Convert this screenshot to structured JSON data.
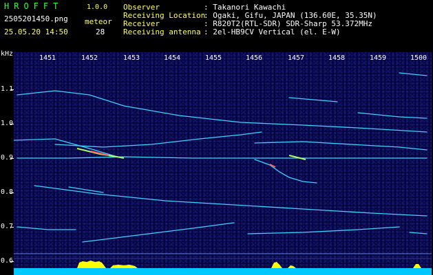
{
  "header": {
    "brand": "HROFFT",
    "version": "1.0.0",
    "filename": "2505201450.png",
    "datetime": "25.05.20 14:50",
    "meteor_label": "meteor",
    "meteor_count": "28"
  },
  "info": [
    {
      "key": "Observer",
      "value": ": Takanori Kawachi"
    },
    {
      "key": "Receiving Location",
      "value": ": Ogaki, Gifu, JAPAN (136.60E, 35.35N)"
    },
    {
      "key": "Receiver",
      "value": ": R820T2(RTL-SDR) SDR-Sharp 53.372MHz"
    },
    {
      "key": "Receiving antenna",
      "value": ": 2el-HB9CV Vertical (el. E-W)"
    }
  ],
  "axis": {
    "y_unit": "kHz",
    "y_labels": [
      "1.1",
      "1.0",
      "0.9",
      "0.8",
      "0.7",
      "0.6"
    ],
    "x_labels": [
      "1451",
      "1452",
      "1453",
      "1454",
      "1455",
      "1456",
      "1457",
      "1458",
      "1459",
      "1500"
    ]
  },
  "colors": {
    "background": "#000000",
    "plot_bg": "#06063e",
    "trace": "#3fd3ff",
    "meteor_hot": "#ff6060",
    "meteor_warm": "#b0ff60",
    "bottom_bar": "#00c8ff",
    "signal_peak": "#ffff00"
  }
}
